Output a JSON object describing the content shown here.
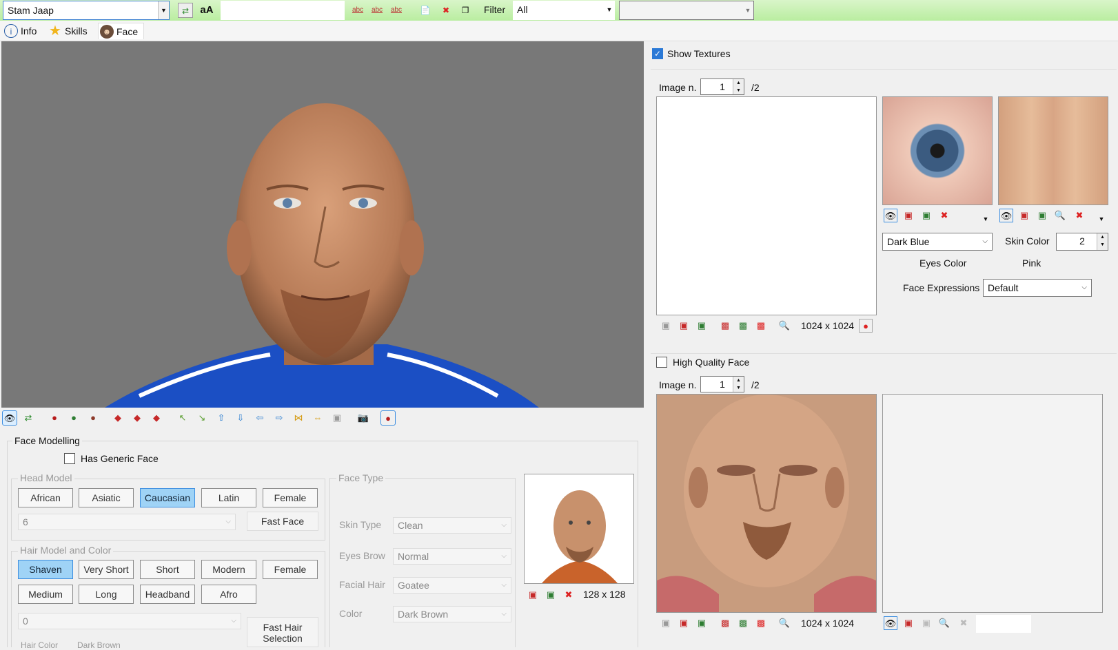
{
  "toolbar": {
    "player": "Stam Jaap",
    "font_label": "aA",
    "filter_label": "Filter",
    "filter_value": "All",
    "abc": "abc"
  },
  "tabs": [
    {
      "label": "Info",
      "icon": "info-icon"
    },
    {
      "label": "Skills",
      "icon": "star-icon"
    },
    {
      "label": "Face",
      "icon": "face-icon"
    }
  ],
  "face_modelling": {
    "title": "Face Modelling",
    "generic_face": "Has Generic Face",
    "head_model": {
      "label": "Head Model",
      "buttons": [
        "African",
        "Asiatic",
        "Caucasian",
        "Latin",
        "Female"
      ],
      "selected": "Caucasian",
      "value": "6",
      "fast_face": "Fast Face"
    },
    "hair_model": {
      "label": "Hair Model and Color",
      "buttons": [
        "Shaven",
        "Very Short",
        "Short",
        "Modern",
        "Female",
        "Medium",
        "Long",
        "Headband",
        "Afro"
      ],
      "selected": "Shaven",
      "value": "0",
      "fast_hair": "Fast Hair Selection",
      "hair_color_label": "Hair Color",
      "hair_color_value": "Dark Brown"
    },
    "face_type": {
      "label": "Face Type",
      "skin_type_label": "Skin Type",
      "skin_type": "Clean",
      "eyes_brow_label": "Eyes Brow",
      "eyes_brow": "Normal",
      "facial_hair_label": "Facial Hair",
      "facial_hair": "Goatee",
      "color_label": "Color",
      "color": "Dark Brown"
    },
    "portrait_size": "128 x 128"
  },
  "textures": {
    "show_label": "Show Textures",
    "image_label": "Image n.",
    "image_value": "1",
    "image_total": "/2",
    "size": "1024 x 1024",
    "eyes_color_value": "Dark Blue",
    "eyes_color_label": "Eyes Color",
    "skin_color_label": "Skin Color",
    "skin_color_value": "2",
    "skin_color_name": "Pink",
    "face_expressions_label": "Face Expressions",
    "face_expressions_value": "Default"
  },
  "hq": {
    "label": "High Quality Face",
    "image_label": "Image n.",
    "image_value": "1",
    "image_total": "/2",
    "size": "1024 x 1024"
  },
  "colors": {
    "toolbar_green": "#c4f0ae",
    "selected_button": "#9fd3f6",
    "viewport": "#787878"
  }
}
